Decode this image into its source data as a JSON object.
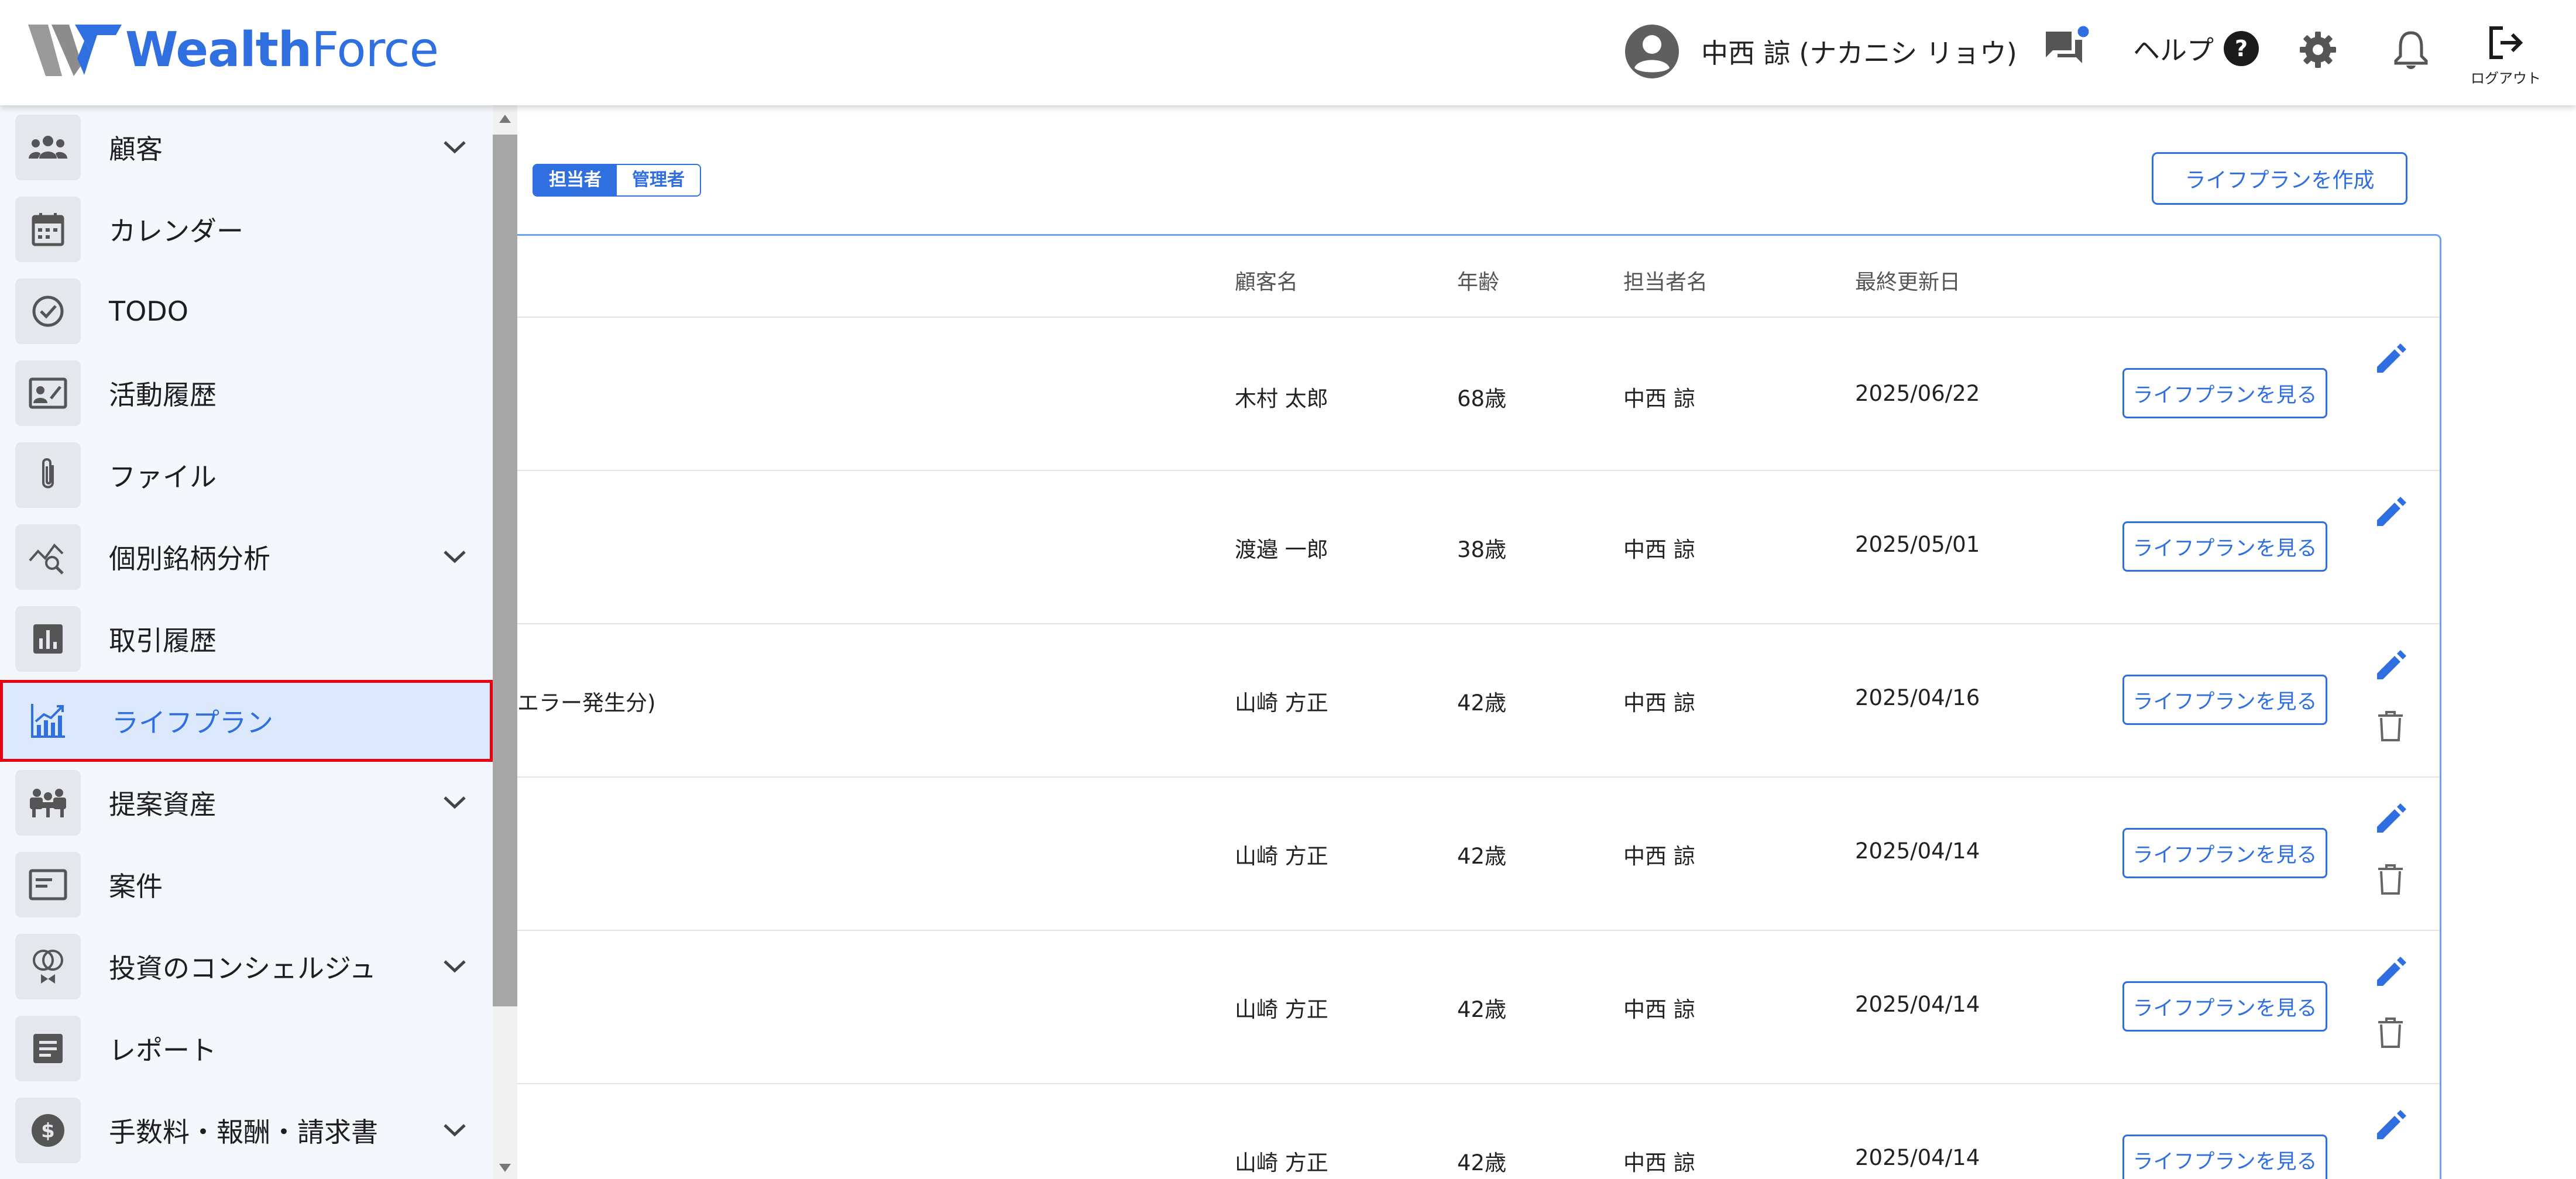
{
  "header": {
    "brand_bold": "Wealth",
    "brand_light": "Force",
    "user_name": "中西 諒 (ナカニシ リョウ)",
    "help_label": "ヘルプ",
    "logout_label": "ログアウト"
  },
  "sidebar": {
    "items": [
      {
        "label": "顧客",
        "icon": "people-icon",
        "has_chevron": true
      },
      {
        "label": "カレンダー",
        "icon": "calendar-icon",
        "has_chevron": false
      },
      {
        "label": "TODO",
        "icon": "check-circle-icon",
        "has_chevron": false
      },
      {
        "label": "活動履歴",
        "icon": "activity-icon",
        "has_chevron": false
      },
      {
        "label": "ファイル",
        "icon": "paperclip-icon",
        "has_chevron": false
      },
      {
        "label": "個別銘柄分析",
        "icon": "chart-search-icon",
        "has_chevron": true
      },
      {
        "label": "取引履歴",
        "icon": "bar-chart-icon",
        "has_chevron": false
      },
      {
        "label": "ライフプラン",
        "icon": "growth-chart-icon",
        "has_chevron": false,
        "active": true
      },
      {
        "label": "提案資産",
        "icon": "meeting-icon",
        "has_chevron": true
      },
      {
        "label": "案件",
        "icon": "card-icon",
        "has_chevron": false
      },
      {
        "label": "投資のコンシェルジュ",
        "icon": "concierge-icon",
        "has_chevron": true
      },
      {
        "label": "レポート",
        "icon": "report-icon",
        "has_chevron": false
      },
      {
        "label": "手数料・報酬・請求書",
        "icon": "dollar-icon",
        "has_chevron": true
      }
    ]
  },
  "main": {
    "toggle": {
      "assignee": "担当者",
      "admin": "管理者"
    },
    "create_button": "ライフプランを作成",
    "columns": {
      "customer": "顧客名",
      "age": "年齢",
      "assignee": "担当者名",
      "updated": "最終更新日"
    },
    "rows": [
      {
        "title": "",
        "customer": "木村 太郎",
        "age": "68歳",
        "assignee": "中西 諒",
        "updated": "2025/06/22",
        "button": "ライフプランを見る",
        "deletable": false
      },
      {
        "title": "",
        "customer": "渡邉 一郎",
        "age": "38歳",
        "assignee": "中西 諒",
        "updated": "2025/05/01",
        "button": "ライフプランを見る",
        "deletable": false
      },
      {
        "title": "エラー発生分)",
        "customer": "山崎 方正",
        "age": "42歳",
        "assignee": "中西 諒",
        "updated": "2025/04/16",
        "button": "ライフプランを見る",
        "deletable": true
      },
      {
        "title": "",
        "customer": "山崎 方正",
        "age": "42歳",
        "assignee": "中西 諒",
        "updated": "2025/04/14",
        "button": "ライフプランを見る",
        "deletable": true
      },
      {
        "title": "",
        "customer": "山崎 方正",
        "age": "42歳",
        "assignee": "中西 諒",
        "updated": "2025/04/14",
        "button": "ライフプランを見る",
        "deletable": true
      },
      {
        "title": "",
        "customer": "山崎 方正",
        "age": "42歳",
        "assignee": "中西 諒",
        "updated": "2025/04/14",
        "button": "ライフプランを見る",
        "deletable": true
      }
    ]
  },
  "colors": {
    "accent": "#2f6fe0",
    "active_border": "#e60012",
    "sidebar_bg": "#f4f8fd",
    "active_bg": "#dce8fb"
  }
}
